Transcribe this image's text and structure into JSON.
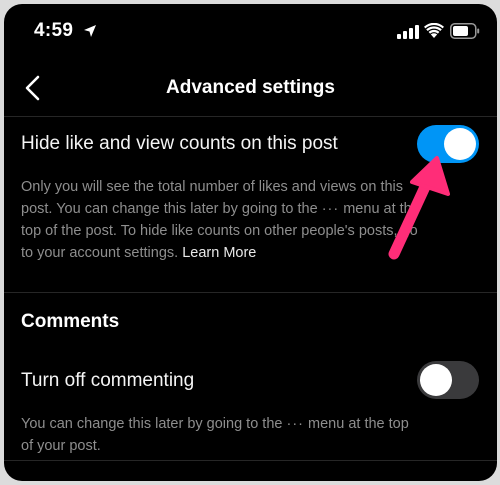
{
  "status_bar": {
    "time": "4:59",
    "icons": [
      "location-arrow-icon",
      "cellular-signal-icon",
      "wifi-icon",
      "battery-icon"
    ]
  },
  "nav": {
    "title": "Advanced settings",
    "back_icon": "chevron-left-icon"
  },
  "hide_counts": {
    "label": "Hide like and view counts on this post",
    "toggle_on": true,
    "desc_line1": "Only you will see the total number of likes and views on this",
    "desc_line2_pre": "post. You can change this later by going to the ",
    "desc_line2_dots": "···",
    "desc_line2_post": " menu at the",
    "desc_line3": "top of the post. To hide like counts on other people's posts, go",
    "desc_line4": "to your account settings. ",
    "learn_more": "Learn More"
  },
  "comments": {
    "heading": "Comments",
    "label": "Turn off commenting",
    "toggle_on": false,
    "desc_line1_pre": "You can change this later by going to the ",
    "desc_line1_dots": "···",
    "desc_line1_post": " menu at the top",
    "desc_line2": "of your post."
  },
  "colors": {
    "background": "#000000",
    "toggle_on": "#0095f6",
    "toggle_off": "#3a3a3c",
    "secondary_text": "#8e8e8e",
    "annotation_arrow": "#ff2d78"
  },
  "annotation": {
    "icon": "pink-arrow-annotation"
  }
}
